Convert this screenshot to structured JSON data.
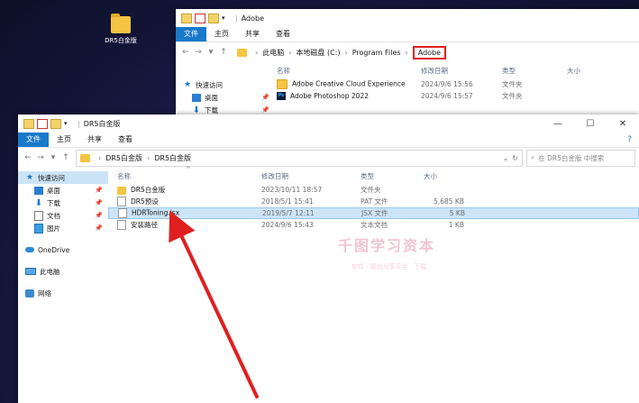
{
  "desktop": {
    "icon_label": "DR5白金版"
  },
  "window_back": {
    "title": "Adobe",
    "ribbon_tabs": [
      "文件",
      "主页",
      "共享",
      "查看"
    ],
    "breadcrumb": [
      "此电脑",
      "本地磁盘 (C:)",
      "Program Files",
      "Adobe"
    ],
    "columns": {
      "name": "名称",
      "date": "修改日期",
      "type": "类型",
      "size": "大小"
    },
    "nav": {
      "quick_access": "快速访问",
      "desktop": "桌面",
      "downloads": "下载"
    },
    "rows": [
      {
        "name": "Adobe Creative Cloud Experience",
        "date": "2024/9/6 15:56",
        "type": "文件夹",
        "size": ""
      },
      {
        "name": "Adobe Photoshop 2022",
        "date": "2024/9/6 15:57",
        "type": "文件夹",
        "size": ""
      }
    ]
  },
  "window_front": {
    "title": "DR5白金版",
    "ribbon_tabs": [
      "文件",
      "主页",
      "共享",
      "查看"
    ],
    "breadcrumb": [
      "DR5白金版",
      "DR5白金版"
    ],
    "search_placeholder": "在 DR5白金版 中搜索",
    "columns": {
      "name": "名称",
      "date": "修改日期",
      "type": "类型",
      "size": "大小"
    },
    "nav": {
      "quick_access": "快速访问",
      "desktop": "桌面",
      "downloads": "下载",
      "documents": "文档",
      "pictures": "图片",
      "onedrive": "OneDrive",
      "this_pc": "此电脑",
      "network": "网络"
    },
    "rows": [
      {
        "name": "DR5白金版",
        "date": "2023/10/11 18:57",
        "type": "文件夹",
        "size": ""
      },
      {
        "name": "DR5预设",
        "date": "2018/5/1 15:41",
        "type": "PAT 文件",
        "size": "5,685 KB"
      },
      {
        "name": "HDRToning.jsx",
        "date": "2019/5/7 12:11",
        "type": "JSX 文件",
        "size": "5 KB",
        "selected": true
      },
      {
        "name": "安装路径",
        "date": "2024/9/6 15:43",
        "type": "文本文档",
        "size": "1 KB"
      }
    ],
    "watermark": "千图学习资本",
    "watermark_sub": "软件 · 原创分享平台 · 下载"
  },
  "colors": {
    "accent": "#1979ca",
    "highlight": "#e02020",
    "selection": "#cce4f7"
  }
}
